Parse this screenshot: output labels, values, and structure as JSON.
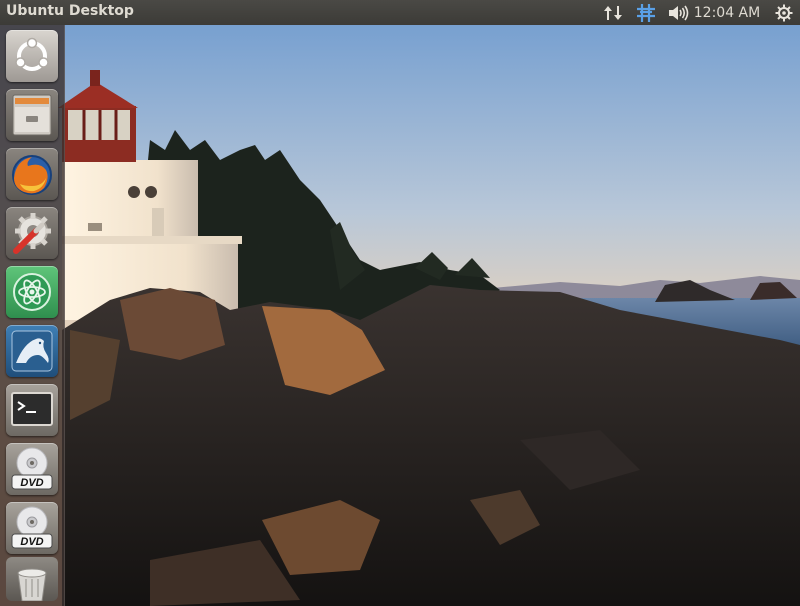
{
  "top_panel": {
    "title": "Ubuntu Desktop",
    "clock": "12:04 AM",
    "indicators": [
      "network-transfer-icon",
      "keyboard-layout-icon",
      "volume-icon",
      "session-gear-icon"
    ]
  },
  "launcher": {
    "items": [
      {
        "icon": "ubuntu-dash-icon"
      },
      {
        "icon": "files-icon"
      },
      {
        "icon": "firefox-icon"
      },
      {
        "icon": "system-settings-icon"
      },
      {
        "icon": "atom-icon"
      },
      {
        "icon": "mysql-workbench-icon"
      },
      {
        "icon": "terminal-icon"
      },
      {
        "icon": "dvd-drive-icon",
        "label": "DVD"
      },
      {
        "icon": "dvd-drive-icon",
        "label": "DVD"
      },
      {
        "icon": "trash-icon"
      }
    ]
  },
  "colors": {
    "panel": "#3c3b37",
    "panel_text": "#dfdbd2",
    "keyboard_indicator": "#4a90d9"
  }
}
